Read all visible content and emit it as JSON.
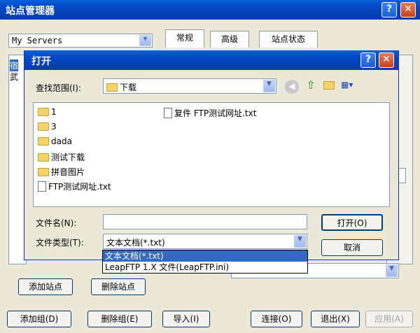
{
  "main_window": {
    "title": "站点管理器",
    "server_select": "My Servers",
    "tabs": [
      "常规",
      "高级",
      "站点状态"
    ],
    "tree_items": [
      "宿",
      "武"
    ],
    "buttons": {
      "add_site": "添加站点",
      "delete_site": "删除站点",
      "add_group": "添加组(D)",
      "delete_group": "删除组(E)",
      "import": "导入(I)",
      "connect": "连接(O)",
      "exit": "退出(X)",
      "apply": "应用(A)"
    }
  },
  "open_dialog": {
    "title": "打开",
    "look_in_label": "查找范围(I):",
    "look_in_value": "下载",
    "files": [
      {
        "name": "1",
        "kind": "folder"
      },
      {
        "name": "3",
        "kind": "folder"
      },
      {
        "name": "dada",
        "kind": "folder"
      },
      {
        "name": "测试下载",
        "kind": "folder"
      },
      {
        "name": "拼音图片",
        "kind": "folder"
      },
      {
        "name": "FTP测试网址.txt",
        "kind": "file"
      },
      {
        "name": "复件 FTP测试网址.txt",
        "kind": "file"
      }
    ],
    "filename_label": "文件名(N):",
    "filename_value": "",
    "filetype_label": "文件类型(T):",
    "filetype_value": "文本文档(*.txt)",
    "filetype_options": [
      "文本文档(*.txt)",
      "LeapFTP 1.X 文件(LeapFTP.ini)"
    ],
    "open_button": "打开(O)",
    "cancel_button": "取消"
  },
  "colors": {
    "titlebar": "#0046c4",
    "window_bg": "#ece9d8",
    "selection": "#316ac5",
    "close_button": "#c8421c"
  }
}
